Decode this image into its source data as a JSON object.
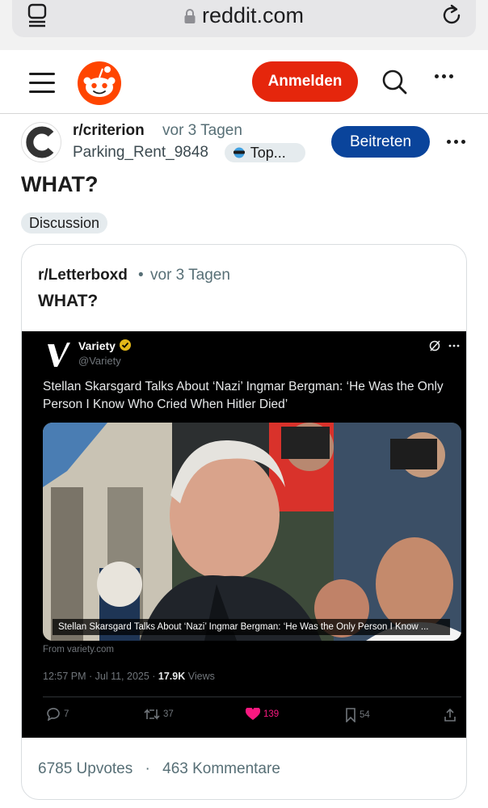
{
  "browser": {
    "url": "reddit.com"
  },
  "header": {
    "login_label": "Anmelden"
  },
  "post": {
    "subreddit": "r/criterion",
    "time": "vor 3 Tagen",
    "author": "Parking_Rent_9848",
    "author_flair": "Top...",
    "join_label": "Beitreten",
    "title": "WHAT?",
    "flair": "Discussion"
  },
  "crosspost": {
    "subreddit": "r/Letterboxd",
    "separator": "•",
    "time": "vor 3 Tagen",
    "title": "WHAT?",
    "upvotes": "6785 Upvotes",
    "dot": "·",
    "comments": "463 Kommentare"
  },
  "tweet": {
    "name": "Variety",
    "handle": "@Variety",
    "text": "Stellan Skarsgard Talks About ‘Nazi’ Ingmar Bergman: ‘He Was the Only Person I Know Who Cried When Hitler Died’",
    "caption": "Stellan Skarsgard Talks About ‘Nazi’ Ingmar Bergman: ‘He Was the Only Person I Know ...",
    "from": "From variety.com",
    "time_prefix": "12:57 PM · Jul 11, 2025 · ",
    "views_count": "17.9K",
    "views_label": " Views",
    "replies": "7",
    "reposts": "37",
    "likes": "139",
    "bookmarks": "54"
  },
  "colors": {
    "reddit_orange": "#e5260c",
    "join_blue": "#0a449b",
    "like_pink": "#f91880"
  }
}
